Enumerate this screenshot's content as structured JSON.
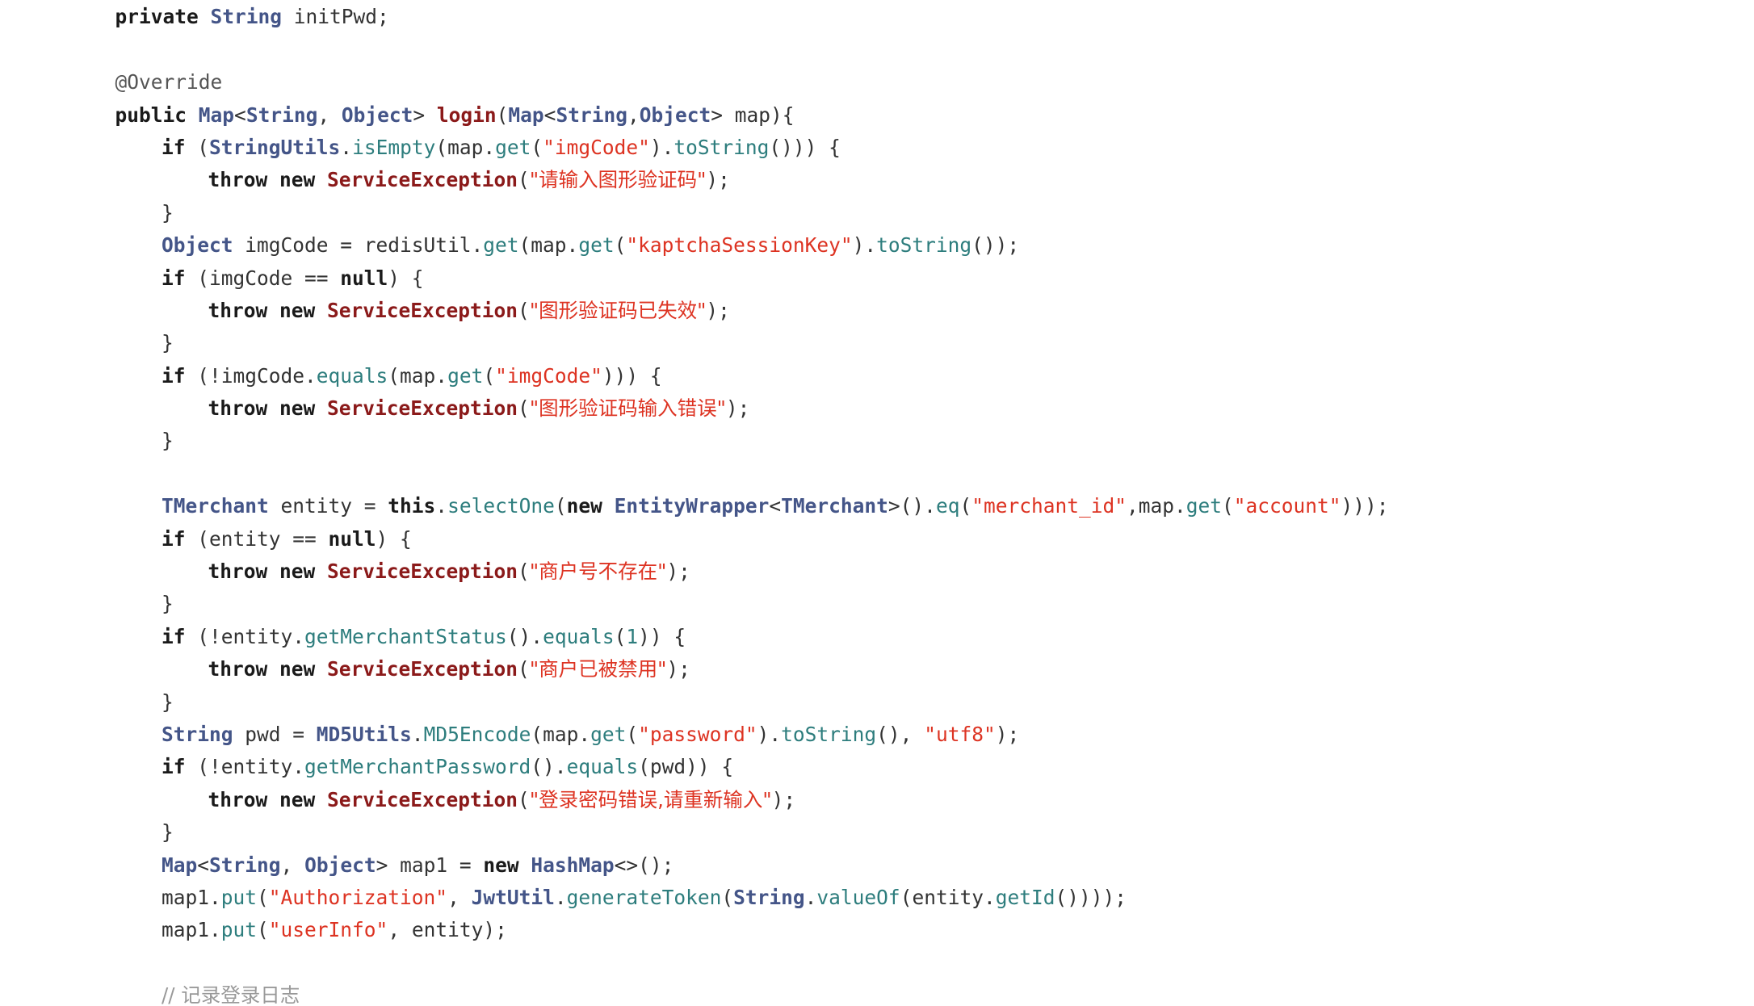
{
  "editor": {
    "language": "Java",
    "theme": "light",
    "background_color": "#ffffff",
    "font_family_kind": "monospace",
    "first_line_clipped": true,
    "colors": {
      "keyword": "#1a1a1a",
      "type": "#445588",
      "method": "#2d7d7d",
      "method_declaration": "#8b1a1a",
      "exception_class": "#8b1a1a",
      "string": "#dd3322",
      "number": "#2d7d7d",
      "annotation": "#555555",
      "comment": "#999999",
      "plain": "#333333"
    }
  },
  "code": {
    "lines": [
      {
        "indent": 1,
        "tokens": [
          {
            "t": "pln",
            "v": "..."
          }
        ]
      },
      {
        "indent": 1,
        "tokens": [
          {
            "t": "kw",
            "v": "private"
          },
          {
            "t": "pln",
            "v": " "
          },
          {
            "t": "type",
            "v": "String"
          },
          {
            "t": "pln",
            "v": " initPwd;"
          }
        ]
      },
      {
        "indent": 0,
        "tokens": []
      },
      {
        "indent": 1,
        "tokens": [
          {
            "t": "ann",
            "v": "@Override"
          }
        ]
      },
      {
        "indent": 1,
        "tokens": [
          {
            "t": "kw",
            "v": "public"
          },
          {
            "t": "pln",
            "v": " "
          },
          {
            "t": "type",
            "v": "Map"
          },
          {
            "t": "pln",
            "v": "<"
          },
          {
            "t": "type",
            "v": "String"
          },
          {
            "t": "pln",
            "v": ", "
          },
          {
            "t": "type",
            "v": "Object"
          },
          {
            "t": "pln",
            "v": "> "
          },
          {
            "t": "fndef",
            "v": "login"
          },
          {
            "t": "pln",
            "v": "("
          },
          {
            "t": "type",
            "v": "Map"
          },
          {
            "t": "pln",
            "v": "<"
          },
          {
            "t": "type",
            "v": "String"
          },
          {
            "t": "pln",
            "v": ","
          },
          {
            "t": "type",
            "v": "Object"
          },
          {
            "t": "pln",
            "v": "> map){"
          }
        ]
      },
      {
        "indent": 2,
        "tokens": [
          {
            "t": "kw",
            "v": "if"
          },
          {
            "t": "pln",
            "v": " ("
          },
          {
            "t": "type",
            "v": "StringUtils"
          },
          {
            "t": "pln",
            "v": "."
          },
          {
            "t": "fn",
            "v": "isEmpty"
          },
          {
            "t": "pln",
            "v": "(map."
          },
          {
            "t": "fn",
            "v": "get"
          },
          {
            "t": "pln",
            "v": "("
          },
          {
            "t": "str",
            "v": "\"imgCode\""
          },
          {
            "t": "pln",
            "v": ")."
          },
          {
            "t": "fn",
            "v": "toString"
          },
          {
            "t": "pln",
            "v": "())) {"
          }
        ]
      },
      {
        "indent": 3,
        "tokens": [
          {
            "t": "kw",
            "v": "throw new"
          },
          {
            "t": "pln",
            "v": " "
          },
          {
            "t": "exc",
            "v": "ServiceException"
          },
          {
            "t": "pln",
            "v": "("
          },
          {
            "t": "str",
            "v": "\"请输入图形验证码\"",
            "cjk": true
          },
          {
            "t": "pln",
            "v": ");"
          }
        ]
      },
      {
        "indent": 2,
        "tokens": [
          {
            "t": "pln",
            "v": "}"
          }
        ]
      },
      {
        "indent": 2,
        "tokens": [
          {
            "t": "type",
            "v": "Object"
          },
          {
            "t": "pln",
            "v": " imgCode = redisUtil."
          },
          {
            "t": "fn",
            "v": "get"
          },
          {
            "t": "pln",
            "v": "(map."
          },
          {
            "t": "fn",
            "v": "get"
          },
          {
            "t": "pln",
            "v": "("
          },
          {
            "t": "str",
            "v": "\"kaptchaSessionKey\""
          },
          {
            "t": "pln",
            "v": ")."
          },
          {
            "t": "fn",
            "v": "toString"
          },
          {
            "t": "pln",
            "v": "());"
          }
        ]
      },
      {
        "indent": 2,
        "tokens": [
          {
            "t": "kw",
            "v": "if"
          },
          {
            "t": "pln",
            "v": " (imgCode == "
          },
          {
            "t": "kw",
            "v": "null"
          },
          {
            "t": "pln",
            "v": ") {"
          }
        ]
      },
      {
        "indent": 3,
        "tokens": [
          {
            "t": "kw",
            "v": "throw new"
          },
          {
            "t": "pln",
            "v": " "
          },
          {
            "t": "exc",
            "v": "ServiceException"
          },
          {
            "t": "pln",
            "v": "("
          },
          {
            "t": "str",
            "v": "\"图形验证码已失效\"",
            "cjk": true
          },
          {
            "t": "pln",
            "v": ");"
          }
        ]
      },
      {
        "indent": 2,
        "tokens": [
          {
            "t": "pln",
            "v": "}"
          }
        ]
      },
      {
        "indent": 2,
        "tokens": [
          {
            "t": "kw",
            "v": "if"
          },
          {
            "t": "pln",
            "v": " (!imgCode."
          },
          {
            "t": "fn",
            "v": "equals"
          },
          {
            "t": "pln",
            "v": "(map."
          },
          {
            "t": "fn",
            "v": "get"
          },
          {
            "t": "pln",
            "v": "("
          },
          {
            "t": "str",
            "v": "\"imgCode\""
          },
          {
            "t": "pln",
            "v": "))) {"
          }
        ]
      },
      {
        "indent": 3,
        "tokens": [
          {
            "t": "kw",
            "v": "throw new"
          },
          {
            "t": "pln",
            "v": " "
          },
          {
            "t": "exc",
            "v": "ServiceException"
          },
          {
            "t": "pln",
            "v": "("
          },
          {
            "t": "str",
            "v": "\"图形验证码输入错误\"",
            "cjk": true
          },
          {
            "t": "pln",
            "v": ");"
          }
        ]
      },
      {
        "indent": 2,
        "tokens": [
          {
            "t": "pln",
            "v": "}"
          }
        ]
      },
      {
        "indent": 0,
        "tokens": []
      },
      {
        "indent": 2,
        "tokens": [
          {
            "t": "type",
            "v": "TMerchant"
          },
          {
            "t": "pln",
            "v": " entity = "
          },
          {
            "t": "kw",
            "v": "this"
          },
          {
            "t": "pln",
            "v": "."
          },
          {
            "t": "fn",
            "v": "selectOne"
          },
          {
            "t": "pln",
            "v": "("
          },
          {
            "t": "kw",
            "v": "new"
          },
          {
            "t": "pln",
            "v": " "
          },
          {
            "t": "type",
            "v": "EntityWrapper"
          },
          {
            "t": "pln",
            "v": "<"
          },
          {
            "t": "type",
            "v": "TMerchant"
          },
          {
            "t": "pln",
            "v": ">()."
          },
          {
            "t": "fn",
            "v": "eq"
          },
          {
            "t": "pln",
            "v": "("
          },
          {
            "t": "str",
            "v": "\"merchant_id\""
          },
          {
            "t": "pln",
            "v": ",map."
          },
          {
            "t": "fn",
            "v": "get"
          },
          {
            "t": "pln",
            "v": "("
          },
          {
            "t": "str",
            "v": "\"account\""
          },
          {
            "t": "pln",
            "v": ")));"
          }
        ]
      },
      {
        "indent": 2,
        "tokens": [
          {
            "t": "kw",
            "v": "if"
          },
          {
            "t": "pln",
            "v": " (entity == "
          },
          {
            "t": "kw",
            "v": "null"
          },
          {
            "t": "pln",
            "v": ") {"
          }
        ]
      },
      {
        "indent": 3,
        "tokens": [
          {
            "t": "kw",
            "v": "throw new"
          },
          {
            "t": "pln",
            "v": " "
          },
          {
            "t": "exc",
            "v": "ServiceException"
          },
          {
            "t": "pln",
            "v": "("
          },
          {
            "t": "str",
            "v": "\"商户号不存在\"",
            "cjk": true
          },
          {
            "t": "pln",
            "v": ");"
          }
        ]
      },
      {
        "indent": 2,
        "tokens": [
          {
            "t": "pln",
            "v": "}"
          }
        ]
      },
      {
        "indent": 2,
        "tokens": [
          {
            "t": "kw",
            "v": "if"
          },
          {
            "t": "pln",
            "v": " (!entity."
          },
          {
            "t": "fn",
            "v": "getMerchantStatus"
          },
          {
            "t": "pln",
            "v": "()."
          },
          {
            "t": "fn",
            "v": "equals"
          },
          {
            "t": "pln",
            "v": "("
          },
          {
            "t": "num",
            "v": "1"
          },
          {
            "t": "pln",
            "v": ")) {"
          }
        ]
      },
      {
        "indent": 3,
        "tokens": [
          {
            "t": "kw",
            "v": "throw new"
          },
          {
            "t": "pln",
            "v": " "
          },
          {
            "t": "exc",
            "v": "ServiceException"
          },
          {
            "t": "pln",
            "v": "("
          },
          {
            "t": "str",
            "v": "\"商户已被禁用\"",
            "cjk": true
          },
          {
            "t": "pln",
            "v": ");"
          }
        ]
      },
      {
        "indent": 2,
        "tokens": [
          {
            "t": "pln",
            "v": "}"
          }
        ]
      },
      {
        "indent": 2,
        "tokens": [
          {
            "t": "type",
            "v": "String"
          },
          {
            "t": "pln",
            "v": " pwd = "
          },
          {
            "t": "type",
            "v": "MD5Utils"
          },
          {
            "t": "pln",
            "v": "."
          },
          {
            "t": "fn",
            "v": "MD5Encode"
          },
          {
            "t": "pln",
            "v": "(map."
          },
          {
            "t": "fn",
            "v": "get"
          },
          {
            "t": "pln",
            "v": "("
          },
          {
            "t": "str",
            "v": "\"password\""
          },
          {
            "t": "pln",
            "v": ")."
          },
          {
            "t": "fn",
            "v": "toString"
          },
          {
            "t": "pln",
            "v": "(), "
          },
          {
            "t": "str",
            "v": "\"utf8\""
          },
          {
            "t": "pln",
            "v": ");"
          }
        ]
      },
      {
        "indent": 2,
        "tokens": [
          {
            "t": "kw",
            "v": "if"
          },
          {
            "t": "pln",
            "v": " (!entity."
          },
          {
            "t": "fn",
            "v": "getMerchantPassword"
          },
          {
            "t": "pln",
            "v": "()."
          },
          {
            "t": "fn",
            "v": "equals"
          },
          {
            "t": "pln",
            "v": "(pwd)) {"
          }
        ]
      },
      {
        "indent": 3,
        "tokens": [
          {
            "t": "kw",
            "v": "throw new"
          },
          {
            "t": "pln",
            "v": " "
          },
          {
            "t": "exc",
            "v": "ServiceException"
          },
          {
            "t": "pln",
            "v": "("
          },
          {
            "t": "str",
            "v": "\"登录密码错误,请重新输入\"",
            "cjk": true
          },
          {
            "t": "pln",
            "v": ");"
          }
        ]
      },
      {
        "indent": 2,
        "tokens": [
          {
            "t": "pln",
            "v": "}"
          }
        ]
      },
      {
        "indent": 2,
        "tokens": [
          {
            "t": "type",
            "v": "Map"
          },
          {
            "t": "pln",
            "v": "<"
          },
          {
            "t": "type",
            "v": "String"
          },
          {
            "t": "pln",
            "v": ", "
          },
          {
            "t": "type",
            "v": "Object"
          },
          {
            "t": "pln",
            "v": "> map1 = "
          },
          {
            "t": "kw",
            "v": "new"
          },
          {
            "t": "pln",
            "v": " "
          },
          {
            "t": "type",
            "v": "HashMap"
          },
          {
            "t": "pln",
            "v": "<>();"
          }
        ]
      },
      {
        "indent": 2,
        "tokens": [
          {
            "t": "pln",
            "v": "map1."
          },
          {
            "t": "fn",
            "v": "put"
          },
          {
            "t": "pln",
            "v": "("
          },
          {
            "t": "str",
            "v": "\"Authorization\""
          },
          {
            "t": "pln",
            "v": ", "
          },
          {
            "t": "type",
            "v": "JwtUtil"
          },
          {
            "t": "pln",
            "v": "."
          },
          {
            "t": "fn",
            "v": "generateToken"
          },
          {
            "t": "pln",
            "v": "("
          },
          {
            "t": "type",
            "v": "String"
          },
          {
            "t": "pln",
            "v": "."
          },
          {
            "t": "fn",
            "v": "valueOf"
          },
          {
            "t": "pln",
            "v": "(entity."
          },
          {
            "t": "fn",
            "v": "getId"
          },
          {
            "t": "pln",
            "v": "())));"
          }
        ]
      },
      {
        "indent": 2,
        "tokens": [
          {
            "t": "pln",
            "v": "map1."
          },
          {
            "t": "fn",
            "v": "put"
          },
          {
            "t": "pln",
            "v": "("
          },
          {
            "t": "str",
            "v": "\"userInfo\""
          },
          {
            "t": "pln",
            "v": ", entity);"
          }
        ]
      },
      {
        "indent": 0,
        "tokens": []
      },
      {
        "indent": 2,
        "tokens": [
          {
            "t": "cmt",
            "v": "// 记录登录日志",
            "cjk": true
          }
        ]
      }
    ]
  }
}
